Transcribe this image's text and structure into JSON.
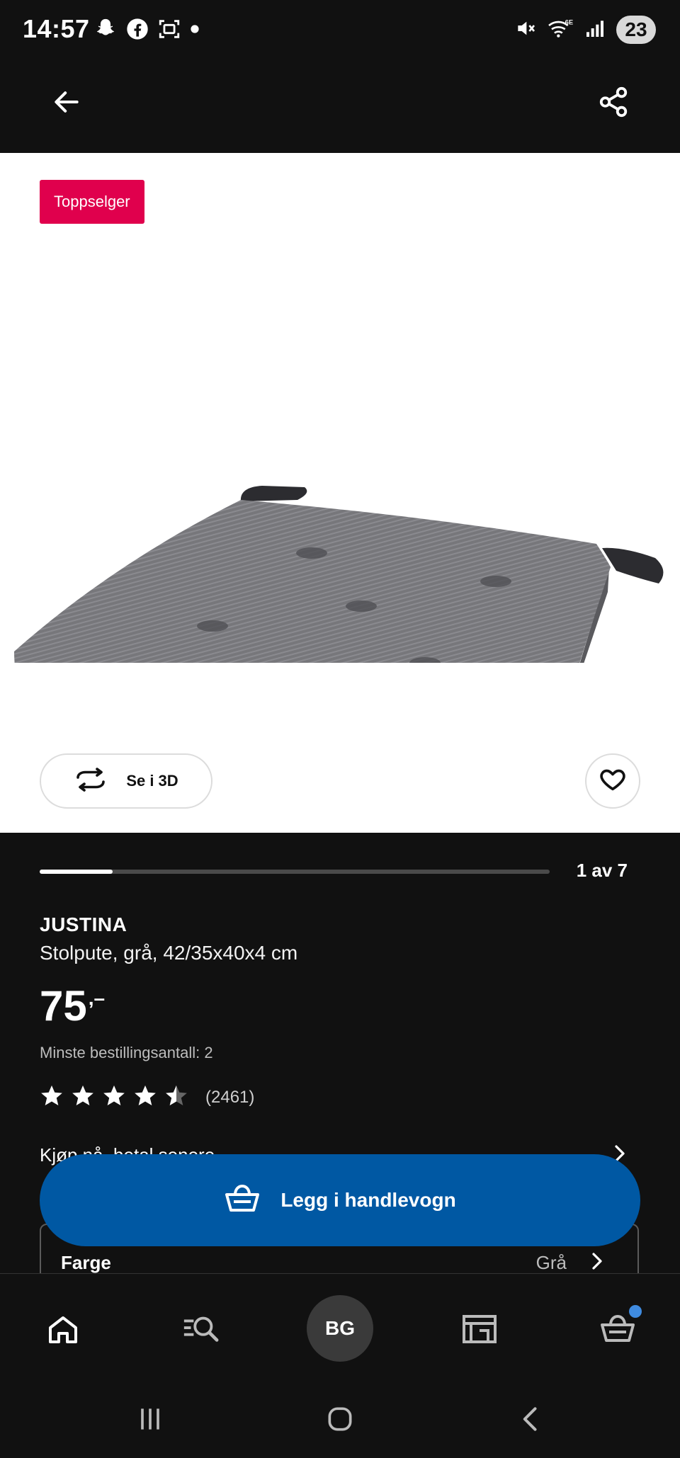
{
  "status_bar": {
    "time": "14:57",
    "left_icons": [
      "snapchat-icon",
      "facebook-icon",
      "screenshot-icon",
      "dot-icon"
    ],
    "right_icons": [
      "mute-icon",
      "wifi-6e-icon",
      "signal-icon"
    ],
    "battery": "23"
  },
  "top_bar": {
    "back_icon": "arrow-left-icon",
    "share_icon": "share-icon"
  },
  "gallery": {
    "badge": "Toppselger",
    "view3d_label": "Se i 3D",
    "progress_label": "1 av 7",
    "progress_fraction": 0.143
  },
  "product": {
    "name": "JUSTINA",
    "description": "Stolpute, grå, 42/35x40x4 cm",
    "price": "75",
    "price_suffix": ",–",
    "min_order": "Minste bestillingsantall: 2",
    "rating": 4.5,
    "rating_count": "(2461)",
    "pay_later": "Kjøp nå, betal senere"
  },
  "color_selector": {
    "label": "Farge",
    "value": "Grå"
  },
  "cart_button": {
    "label": "Legg i handlevogn"
  },
  "bottom_nav": {
    "items": [
      "home-icon",
      "search-list-icon",
      "avatar",
      "store-icon",
      "cart-icon"
    ],
    "avatar_initials": "BG"
  },
  "colors": {
    "background": "#111111",
    "primary_button": "#0058a3",
    "badge": "#e0004d",
    "notification_dot": "#3f8be0"
  }
}
